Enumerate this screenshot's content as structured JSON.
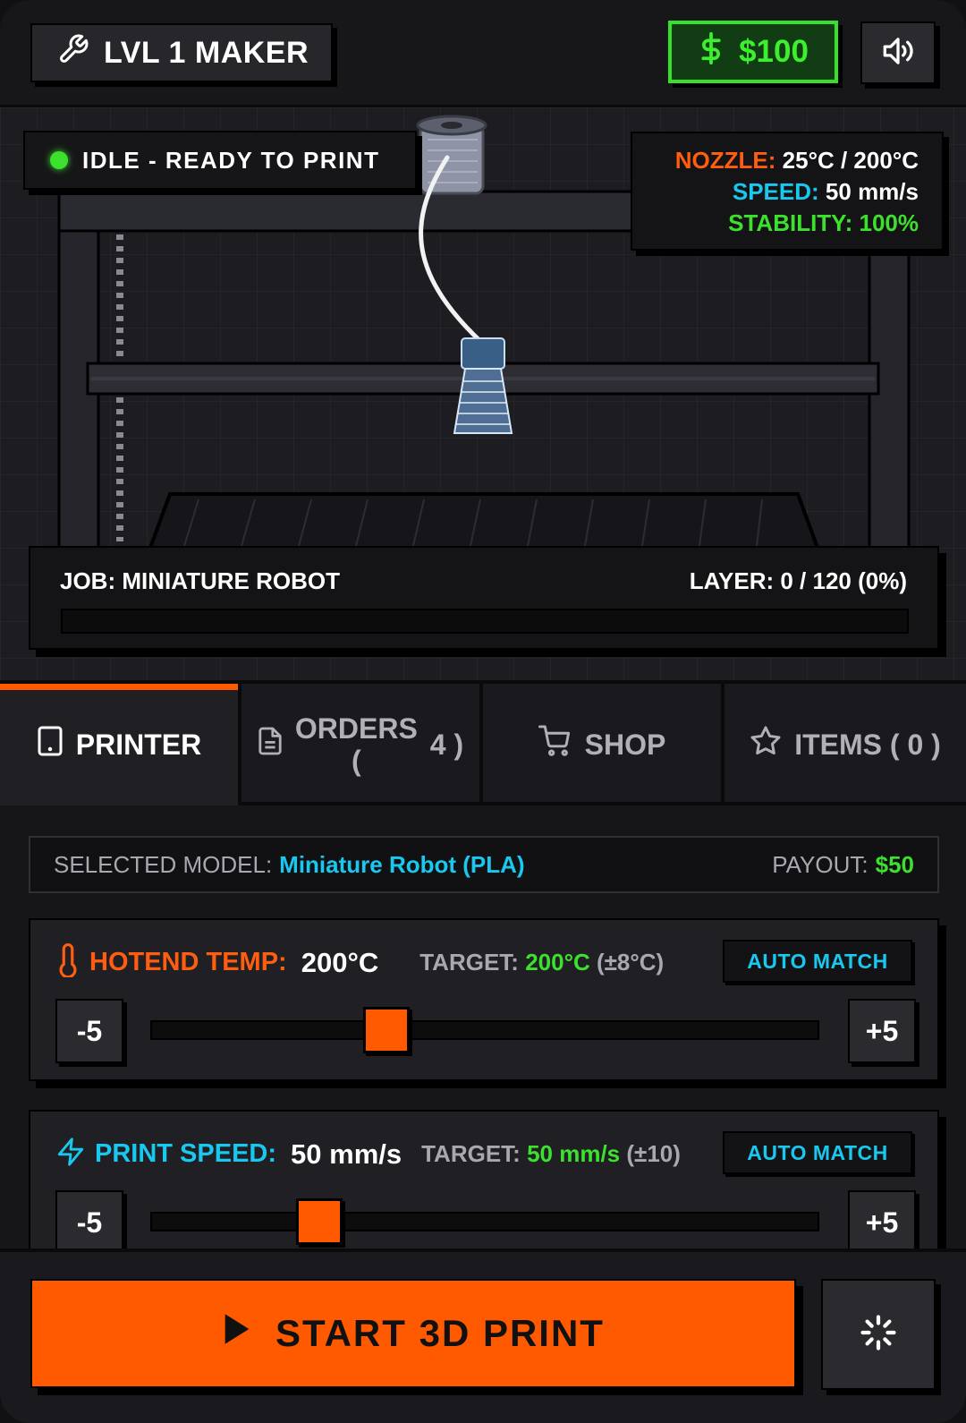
{
  "header": {
    "level_label": "LVL 1 MAKER",
    "money": "$100",
    "icons": {
      "level": "wrench-icon",
      "money": "dollar-icon",
      "sound": "speaker-icon"
    }
  },
  "printer": {
    "status": "IDLE - READY TO PRINT",
    "stats": {
      "nozzle_label": "NOZZLE:",
      "nozzle_value": "25°C / 200°C",
      "speed_label": "SPEED:",
      "speed_value": "50 mm/s",
      "stability_label": "STABILITY:",
      "stability_value": "100%"
    },
    "job": "JOB: MINIATURE ROBOT",
    "layer": "LAYER: 0 / 120 (0%)",
    "progress_percent": 0
  },
  "tabs": [
    {
      "label": "PRINTER",
      "icon": "tablet-icon",
      "active": true
    },
    {
      "label_top": "ORDERS",
      "label_bottom": "(",
      "count": "4 )",
      "icon": "document-icon"
    },
    {
      "label": "SHOP",
      "icon": "cart-icon"
    },
    {
      "label": "ITEMS ( 0 )",
      "icon": "star-icon"
    }
  ],
  "panel": {
    "selected_label": "SELECTED MODEL:",
    "selected_model": "Miniature Robot (PLA)",
    "payout_label": "PAYOUT:",
    "payout_value": "$50",
    "controls": {
      "hotend": {
        "label": "HOTEND TEMP:",
        "value": "200°C",
        "target_label": "TARGET:",
        "target_value": "200°C",
        "tolerance": "(±8°C)",
        "auto_label": "AUTO MATCH",
        "minus": "-5",
        "plus": "+5",
        "slider_fraction": 0.35,
        "icon": "thermometer-icon"
      },
      "speed": {
        "label": "PRINT SPEED:",
        "value": "50 mm/s",
        "target_label": "TARGET:",
        "target_value": "50 mm/s",
        "tolerance": "(±10)",
        "auto_label": "AUTO MATCH",
        "minus": "-5",
        "plus": "+5",
        "slider_fraction": 0.25,
        "icon": "lightning-icon"
      }
    }
  },
  "footer": {
    "start_label": "START 3D PRINT",
    "icons": {
      "start": "play-icon",
      "settings": "loader-icon"
    }
  },
  "colors": {
    "accent": "#ff5a00",
    "cyan": "#19c8ef",
    "green": "#3ce12e",
    "background": "#141416"
  }
}
